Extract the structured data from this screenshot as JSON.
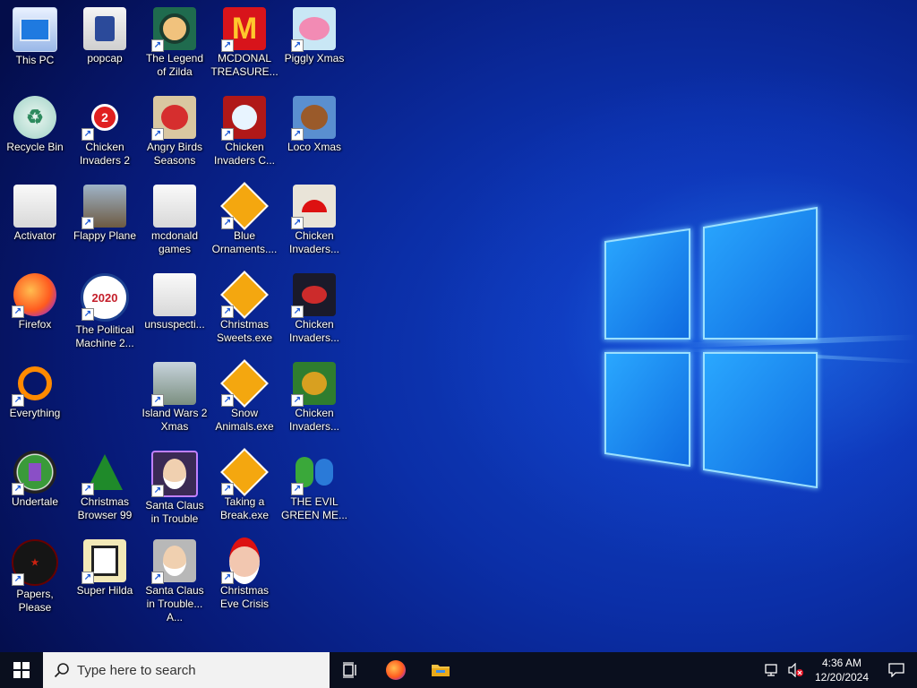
{
  "desktop": {
    "icons": [
      {
        "label": "This PC",
        "icon": "computer-icon"
      },
      {
        "label": "popcap",
        "icon": "folder-icon"
      },
      {
        "label": "The Legend of Zilda",
        "icon": "game-character-icon"
      },
      {
        "label": "MCDONAL TREASURE...",
        "icon": "mcdonalds-logo-icon"
      },
      {
        "label": "Piggly Xmas",
        "icon": "pig-icon"
      },
      {
        "label": "Recycle Bin",
        "icon": "recycle-bin-icon"
      },
      {
        "label": "Chicken Invaders 2",
        "icon": "chicken-icon"
      },
      {
        "label": "Angry Birds Seasons",
        "icon": "angry-bird-icon"
      },
      {
        "label": "Chicken Invaders C...",
        "icon": "snowman-chicken-icon"
      },
      {
        "label": "Loco Xmas",
        "icon": "bear-icon"
      },
      {
        "label": "Activator",
        "icon": "folder-icon"
      },
      {
        "label": "Flappy Plane",
        "icon": "plane-icon"
      },
      {
        "label": "mcdonald games",
        "icon": "folder-icon"
      },
      {
        "label": "Blue Ornaments....",
        "icon": "puzzle-icon"
      },
      {
        "label": "Chicken Invaders...",
        "icon": "chicken-santa-icon"
      },
      {
        "label": "Firefox",
        "icon": "firefox-icon"
      },
      {
        "label": "The Political Machine 2...",
        "icon": "political-badge-icon"
      },
      {
        "label": "unsuspecti...",
        "icon": "folder-icon"
      },
      {
        "label": "Christmas Sweets.exe",
        "icon": "puzzle-icon"
      },
      {
        "label": "Chicken Invaders...",
        "icon": "chicken-space-icon"
      },
      {
        "label": "Everything",
        "icon": "magnifier-icon"
      },
      {
        "label": "Island Wars 2 Xmas",
        "icon": "snow-island-icon"
      },
      {
        "label": "Snow Animals.exe",
        "icon": "puzzle-icon"
      },
      {
        "label": "Chicken Invaders...",
        "icon": "chicken-green-icon"
      },
      {
        "label": "Undertale",
        "icon": "undertale-icon"
      },
      {
        "label": "Christmas Browser 99",
        "icon": "christmas-tree-icon"
      },
      {
        "label": "Santa Claus in Trouble",
        "icon": "santa-icon"
      },
      {
        "label": "Taking a Break.exe",
        "icon": "puzzle-icon"
      },
      {
        "label": "THE EVIL GREEN ME...",
        "icon": "messenger-icon"
      },
      {
        "label": "Papers, Please",
        "icon": "papers-please-icon"
      },
      {
        "label": "Super Hilda",
        "icon": "pixel-character-icon"
      },
      {
        "label": "Santa Claus in Trouble... A...",
        "icon": "santa-icon"
      },
      {
        "label": "Christmas Eve Crisis",
        "icon": "santa-face-icon"
      }
    ]
  },
  "taskbar": {
    "search_placeholder": "Type here to search",
    "time": "4:36 AM",
    "date": "12/20/2024",
    "pinned": [
      {
        "name": "task-view-button",
        "icon": "task-view-icon"
      },
      {
        "name": "firefox-taskbar-button",
        "icon": "firefox-icon"
      },
      {
        "name": "file-explorer-button",
        "icon": "folder-icon"
      }
    ]
  },
  "colors": {
    "accent": "#1e5bd6",
    "taskbar": "#0a0f1e",
    "logo": "#3fb6ff"
  }
}
